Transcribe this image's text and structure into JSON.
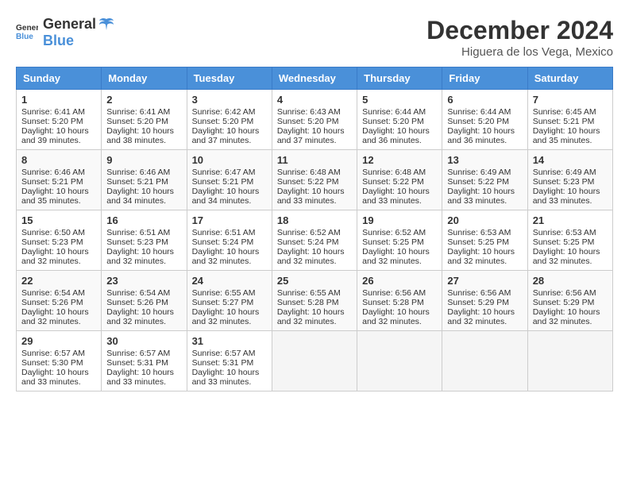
{
  "logo": {
    "general": "General",
    "blue": "Blue"
  },
  "title": {
    "month": "December 2024",
    "location": "Higuera de los Vega, Mexico"
  },
  "headers": [
    "Sunday",
    "Monday",
    "Tuesday",
    "Wednesday",
    "Thursday",
    "Friday",
    "Saturday"
  ],
  "weeks": [
    [
      {
        "day": "1",
        "sunrise": "6:41 AM",
        "sunset": "5:20 PM",
        "daylight": "10 hours and 39 minutes."
      },
      {
        "day": "2",
        "sunrise": "6:41 AM",
        "sunset": "5:20 PM",
        "daylight": "10 hours and 38 minutes."
      },
      {
        "day": "3",
        "sunrise": "6:42 AM",
        "sunset": "5:20 PM",
        "daylight": "10 hours and 37 minutes."
      },
      {
        "day": "4",
        "sunrise": "6:43 AM",
        "sunset": "5:20 PM",
        "daylight": "10 hours and 37 minutes."
      },
      {
        "day": "5",
        "sunrise": "6:44 AM",
        "sunset": "5:20 PM",
        "daylight": "10 hours and 36 minutes."
      },
      {
        "day": "6",
        "sunrise": "6:44 AM",
        "sunset": "5:20 PM",
        "daylight": "10 hours and 36 minutes."
      },
      {
        "day": "7",
        "sunrise": "6:45 AM",
        "sunset": "5:21 PM",
        "daylight": "10 hours and 35 minutes."
      }
    ],
    [
      {
        "day": "8",
        "sunrise": "6:46 AM",
        "sunset": "5:21 PM",
        "daylight": "10 hours and 35 minutes."
      },
      {
        "day": "9",
        "sunrise": "6:46 AM",
        "sunset": "5:21 PM",
        "daylight": "10 hours and 34 minutes."
      },
      {
        "day": "10",
        "sunrise": "6:47 AM",
        "sunset": "5:21 PM",
        "daylight": "10 hours and 34 minutes."
      },
      {
        "day": "11",
        "sunrise": "6:48 AM",
        "sunset": "5:22 PM",
        "daylight": "10 hours and 33 minutes."
      },
      {
        "day": "12",
        "sunrise": "6:48 AM",
        "sunset": "5:22 PM",
        "daylight": "10 hours and 33 minutes."
      },
      {
        "day": "13",
        "sunrise": "6:49 AM",
        "sunset": "5:22 PM",
        "daylight": "10 hours and 33 minutes."
      },
      {
        "day": "14",
        "sunrise": "6:49 AM",
        "sunset": "5:23 PM",
        "daylight": "10 hours and 33 minutes."
      }
    ],
    [
      {
        "day": "15",
        "sunrise": "6:50 AM",
        "sunset": "5:23 PM",
        "daylight": "10 hours and 32 minutes."
      },
      {
        "day": "16",
        "sunrise": "6:51 AM",
        "sunset": "5:23 PM",
        "daylight": "10 hours and 32 minutes."
      },
      {
        "day": "17",
        "sunrise": "6:51 AM",
        "sunset": "5:24 PM",
        "daylight": "10 hours and 32 minutes."
      },
      {
        "day": "18",
        "sunrise": "6:52 AM",
        "sunset": "5:24 PM",
        "daylight": "10 hours and 32 minutes."
      },
      {
        "day": "19",
        "sunrise": "6:52 AM",
        "sunset": "5:25 PM",
        "daylight": "10 hours and 32 minutes."
      },
      {
        "day": "20",
        "sunrise": "6:53 AM",
        "sunset": "5:25 PM",
        "daylight": "10 hours and 32 minutes."
      },
      {
        "day": "21",
        "sunrise": "6:53 AM",
        "sunset": "5:25 PM",
        "daylight": "10 hours and 32 minutes."
      }
    ],
    [
      {
        "day": "22",
        "sunrise": "6:54 AM",
        "sunset": "5:26 PM",
        "daylight": "10 hours and 32 minutes."
      },
      {
        "day": "23",
        "sunrise": "6:54 AM",
        "sunset": "5:26 PM",
        "daylight": "10 hours and 32 minutes."
      },
      {
        "day": "24",
        "sunrise": "6:55 AM",
        "sunset": "5:27 PM",
        "daylight": "10 hours and 32 minutes."
      },
      {
        "day": "25",
        "sunrise": "6:55 AM",
        "sunset": "5:28 PM",
        "daylight": "10 hours and 32 minutes."
      },
      {
        "day": "26",
        "sunrise": "6:56 AM",
        "sunset": "5:28 PM",
        "daylight": "10 hours and 32 minutes."
      },
      {
        "day": "27",
        "sunrise": "6:56 AM",
        "sunset": "5:29 PM",
        "daylight": "10 hours and 32 minutes."
      },
      {
        "day": "28",
        "sunrise": "6:56 AM",
        "sunset": "5:29 PM",
        "daylight": "10 hours and 32 minutes."
      }
    ],
    [
      {
        "day": "29",
        "sunrise": "6:57 AM",
        "sunset": "5:30 PM",
        "daylight": "10 hours and 33 minutes."
      },
      {
        "day": "30",
        "sunrise": "6:57 AM",
        "sunset": "5:31 PM",
        "daylight": "10 hours and 33 minutes."
      },
      {
        "day": "31",
        "sunrise": "6:57 AM",
        "sunset": "5:31 PM",
        "daylight": "10 hours and 33 minutes."
      },
      null,
      null,
      null,
      null
    ]
  ]
}
